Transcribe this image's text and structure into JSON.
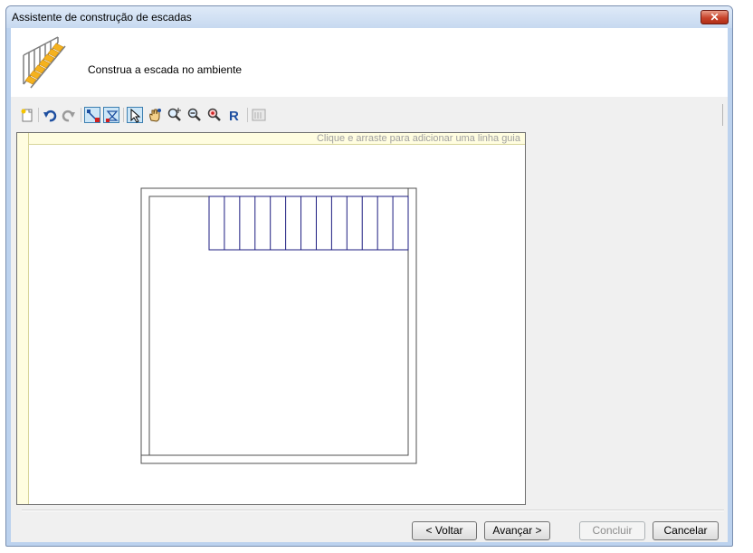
{
  "window": {
    "title": "Assistente de construção de escadas",
    "close_glyph": "✕"
  },
  "header": {
    "text": "Construa a escada no ambiente",
    "icon": "staircase-icon"
  },
  "toolbar": {
    "buttons": [
      {
        "name": "new-icon"
      },
      {
        "name": "undo-icon"
      },
      {
        "name": "redo-icon"
      },
      {
        "name": "draw-line-icon",
        "pressed": true
      },
      {
        "name": "draw-polygon-icon",
        "pressed": true
      },
      {
        "name": "select-pointer-icon",
        "pressed": true
      },
      {
        "name": "pan-hand-icon"
      },
      {
        "name": "zoom-in-icon"
      },
      {
        "name": "zoom-out-icon"
      },
      {
        "name": "zoom-window-icon"
      },
      {
        "name": "redraw-icon"
      },
      {
        "name": "properties-icon"
      }
    ]
  },
  "canvas": {
    "ruler_hint": "Clique e arraste para adicionar uma linha guia",
    "treads": 13
  },
  "buttons": {
    "back": "< Voltar",
    "next": "Avançar >",
    "finish": "Concluir",
    "cancel": "Cancelar"
  },
  "colors": {
    "stair_lines": "#1c1c80",
    "accent": "#3c7fb1",
    "step_yellow": "#f5b21e"
  }
}
